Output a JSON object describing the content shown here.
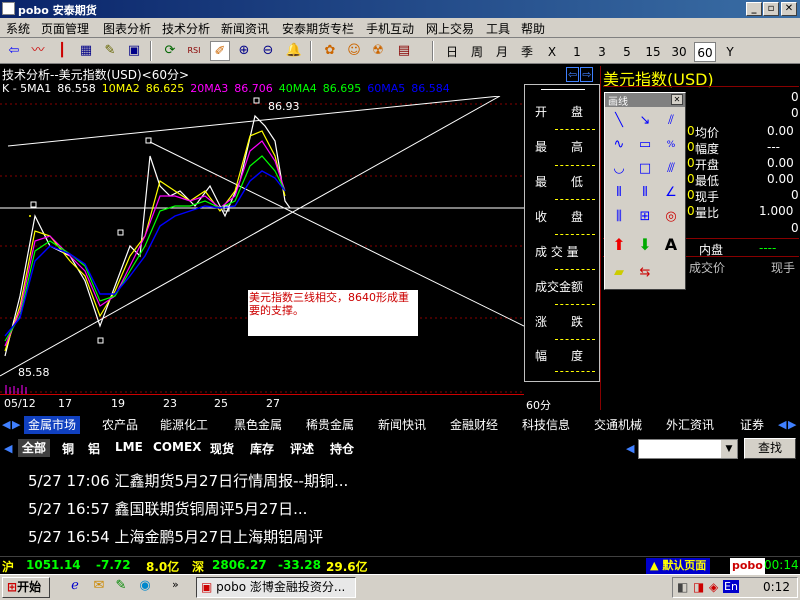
{
  "window": {
    "title": "pobo 安泰期货",
    "min": "_",
    "max": "▫",
    "close": "✕"
  },
  "menu": [
    "系统",
    "页面管理",
    "图表分析",
    "技术分析",
    "新闻资讯",
    "安泰期货专栏",
    "手机互动",
    "网上交易",
    "工具",
    "帮助"
  ],
  "toolbar": {
    "periods": [
      "日",
      "周",
      "月",
      "季",
      "X",
      "1",
      "3",
      "5",
      "15",
      "30",
      "60",
      "Y"
    ],
    "selected_period": "60"
  },
  "chart": {
    "header": "技术分析--美元指数(USD)<60分>",
    "ma": [
      {
        "label": "K - 5MA1",
        "value": "86.558",
        "color": "#ffffff"
      },
      {
        "label": "10MA2",
        "value": "86.625",
        "color": "#ffff00"
      },
      {
        "label": "20MA3",
        "value": "86.706",
        "color": "#ff00ff"
      },
      {
        "label": "40MA4",
        "value": "86.695",
        "color": "#00ff00"
      },
      {
        "label": "60MA5",
        "value": "86.584",
        "color": "#0000ff"
      }
    ],
    "high_label": "86.93",
    "low_label": "85.58",
    "x_ticks": [
      "05/12",
      "17",
      "19",
      "23",
      "25",
      "27"
    ],
    "period_label": "60分",
    "annotation": "美元指数三线相交，8640形成重要的支撑。"
  },
  "chart_data": {
    "type": "line",
    "title": "美元指数(USD)",
    "x": [
      "05/12",
      "17",
      "19",
      "23",
      "25",
      "27"
    ],
    "series": [
      {
        "name": "K",
        "values": [
          85.8,
          86.5,
          85.9,
          86.4,
          86.3,
          86.93,
          86.56
        ]
      }
    ],
    "ylim": [
      85.58,
      86.93
    ]
  },
  "info_panel": {
    "labels": [
      "开　　盘",
      "最　　高",
      "最　　低",
      "收　　盘",
      "成 交 量",
      "成交金额",
      "涨　　跌",
      "幅　　度"
    ]
  },
  "right_panel": {
    "title": "美元指数(USD)",
    "rows": [
      {
        "label": "",
        "value": "0"
      },
      {
        "label": "",
        "value": "0"
      },
      {
        "label": "均价",
        "value": "0.00"
      },
      {
        "label": "幅度",
        "value": "---"
      },
      {
        "label": "开盘",
        "value": "0.00"
      },
      {
        "label": "最低",
        "value": "0.00"
      },
      {
        "label": "现手",
        "value": "0"
      },
      {
        "label": "量比",
        "value": "1.000"
      },
      {
        "label": "",
        "value": "0"
      }
    ],
    "left_zeros": [
      "0",
      "0",
      "0",
      "0",
      "0",
      "0"
    ],
    "neipan_label": "内盘",
    "neipan_value": "----",
    "trade_price_label": "成交价",
    "current_hand_label": "现手"
  },
  "draw_palette": {
    "title": "画线",
    "close": "✕"
  },
  "tabs": {
    "items": [
      "金属市场",
      "农产品",
      "能源化工",
      "黑色金属",
      "稀贵金属",
      "新闻快讯",
      "金融财经",
      "科技信息",
      "交通机械",
      "外汇资讯",
      "证券"
    ],
    "active": "金属市场"
  },
  "subtabs": {
    "items": [
      "全部",
      "铜",
      "铝",
      "LME",
      "COMEX",
      "现货",
      "库存",
      "评述",
      "持仓"
    ],
    "active": "全部",
    "search_button": "查找"
  },
  "news": [
    {
      "date": "5/27",
      "time": "17:06",
      "title": "汇鑫期货5月27日行情周报--期铜..."
    },
    {
      "date": "5/27",
      "time": "16:57",
      "title": "鑫国联期货铜周评5月27日..."
    },
    {
      "date": "5/27",
      "time": "16:54",
      "title": "上海金鹏5月27日上海期铝周评"
    }
  ],
  "statusbar": {
    "sh_label": "沪",
    "sh_value": "1051.14",
    "sh_change": "-7.72",
    "sh_amount": "8.0亿",
    "sz_label": "深",
    "sz_value": "2806.27",
    "sz_change": "-33.28",
    "sz_amount": "29.6亿",
    "default_page": "默认页面",
    "brand": "pobo",
    "clock": "00:14"
  },
  "taskbar": {
    "start": "开始",
    "task": "pobo 澎博金融投资分...",
    "ime": "En",
    "clock": "0:12"
  }
}
